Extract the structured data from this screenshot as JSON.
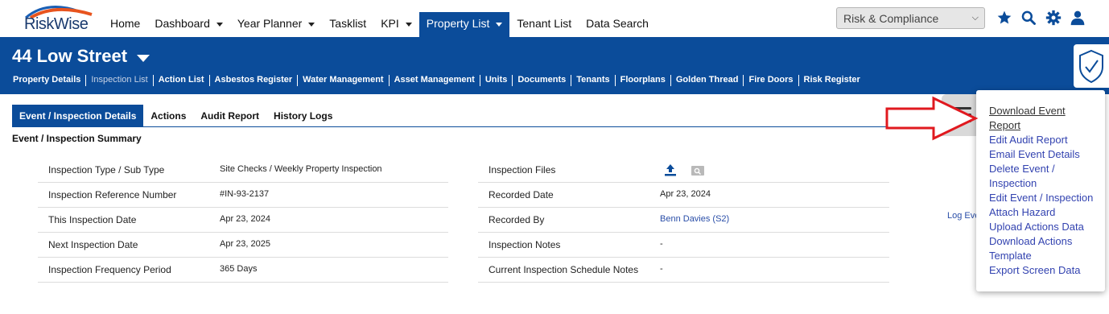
{
  "brand": {
    "name": "RiskWise"
  },
  "nav": {
    "items": [
      {
        "label": "Home",
        "caret": false,
        "active": false
      },
      {
        "label": "Dashboard",
        "caret": true,
        "active": false
      },
      {
        "label": "Year Planner",
        "caret": true,
        "active": false
      },
      {
        "label": "Tasklist",
        "caret": false,
        "active": false
      },
      {
        "label": "KPI",
        "caret": true,
        "active": false
      },
      {
        "label": "Property List",
        "caret": true,
        "active": true
      },
      {
        "label": "Tenant List",
        "caret": false,
        "active": false
      },
      {
        "label": "Data Search",
        "caret": false,
        "active": false
      }
    ],
    "module_select": "Risk & Compliance",
    "icons": [
      "star-icon",
      "search-icon",
      "gear-icon",
      "user-icon"
    ]
  },
  "property": {
    "title": "44 Low Street",
    "subnav": [
      {
        "label": "Property Details",
        "dim": false
      },
      {
        "label": "Inspection List",
        "dim": true
      },
      {
        "label": "Action List",
        "dim": false
      },
      {
        "label": "Asbestos Register",
        "dim": false
      },
      {
        "label": "Water Management",
        "dim": false
      },
      {
        "label": "Asset Management",
        "dim": false
      },
      {
        "label": "Units",
        "dim": false
      },
      {
        "label": "Documents",
        "dim": false
      },
      {
        "label": "Tenants",
        "dim": false
      },
      {
        "label": "Floorplans",
        "dim": false
      },
      {
        "label": "Golden Thread",
        "dim": false
      },
      {
        "label": "Fire Doors",
        "dim": false
      },
      {
        "label": "Risk Register",
        "dim": false
      }
    ]
  },
  "tabs": [
    {
      "label": "Event / Inspection Details",
      "active": true
    },
    {
      "label": "Actions",
      "active": false
    },
    {
      "label": "Audit Report",
      "active": false
    },
    {
      "label": "History Logs",
      "active": false
    }
  ],
  "summary": {
    "title": "Event / Inspection Summary",
    "left": [
      {
        "label": "Inspection Type / Sub Type",
        "value": "Site Checks / Weekly Property Inspection"
      },
      {
        "label": "Inspection Reference Number",
        "value": "#IN-93-2137"
      },
      {
        "label": "This Inspection Date",
        "value": "Apr 23, 2024"
      },
      {
        "label": "Next Inspection Date",
        "value": "Apr 23, 2025"
      },
      {
        "label": "Inspection Frequency Period",
        "value": "365 Days"
      }
    ],
    "right": [
      {
        "label": "Inspection Files",
        "value": ""
      },
      {
        "label": "Recorded Date",
        "value": "Apr 23, 2024"
      },
      {
        "label": "Recorded By",
        "value": "Benn Davies (S2)"
      },
      {
        "label": "Inspection Notes",
        "value": "-"
      },
      {
        "label": "Current Inspection Schedule Notes",
        "value": "-"
      }
    ],
    "log_event_partial": "Log Eve"
  },
  "menu": {
    "items": [
      [
        "Download Event",
        "Report"
      ],
      [
        "Edit Audit Report"
      ],
      [
        "Email Event Details"
      ],
      [
        "Delete Event /",
        "Inspection"
      ],
      [
        "Edit Event / Inspection"
      ],
      [
        "Attach Hazard"
      ],
      [
        "Upload Actions Data"
      ],
      [
        "Download Actions",
        "Template"
      ],
      [
        "Export Screen Data"
      ]
    ]
  },
  "colors": {
    "primary": "#0b4c9a",
    "link": "#3343b0",
    "arrow": "#e0191f"
  }
}
